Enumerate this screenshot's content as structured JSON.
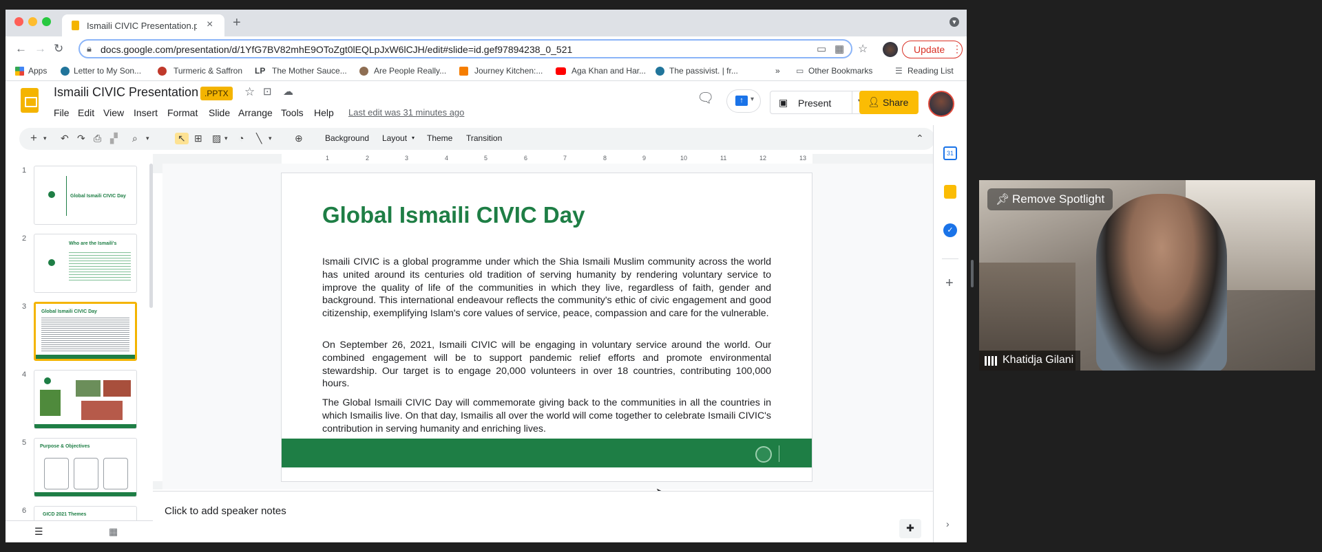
{
  "browser": {
    "tab_title": "Ismaili CIVIC Presentation.pptx",
    "url": "docs.google.com/presentation/d/1YfG7BV82mhE9OToZgt0lEQLpJxW6lCJH/edit#slide=id.gef97894238_0_521",
    "update_label": "Update",
    "bookmarks": [
      "Apps",
      "Letter to My Son...",
      "Turmeric & Saffron",
      "The Mother Sauce...",
      "Are People Really...",
      "Journey Kitchen:...",
      "Aga Khan and Har...",
      "The passivist. | fr..."
    ],
    "other_bookmarks": "Other Bookmarks",
    "reading_list": "Reading List"
  },
  "app": {
    "doc_title": "Ismaili CIVIC Presentation",
    "file_badge": ".PPTX",
    "menu": [
      "File",
      "Edit",
      "View",
      "Insert",
      "Format",
      "Slide",
      "Arrange",
      "Tools",
      "Help"
    ],
    "last_edit": "Last edit was 31 minutes ago",
    "present_label": "Present",
    "share_label": "Share"
  },
  "toolbar": {
    "background": "Background",
    "layout": "Layout",
    "theme": "Theme",
    "transition": "Transition"
  },
  "filmstrip": {
    "slides": [
      {
        "num": "1",
        "title": "Global Ismaili CIVIC Day"
      },
      {
        "num": "2",
        "title": "Who are the Ismaili's"
      },
      {
        "num": "3",
        "title": "Global Ismaili CIVIC Day"
      },
      {
        "num": "4",
        "title": ""
      },
      {
        "num": "5",
        "title": "Purpose & Objectives"
      },
      {
        "num": "6",
        "title": "GICD 2021 Themes"
      }
    ]
  },
  "ruler": [
    "1",
    "2",
    "3",
    "4",
    "5",
    "6",
    "7",
    "8",
    "9",
    "10",
    "11",
    "12",
    "13"
  ],
  "slide": {
    "title": "Global Ismaili CIVIC Day",
    "paragraphs": [
      "Ismaili CIVIC is a global programme under which the Shia Ismaili Muslim community across the world has united around its centuries old tradition of serving humanity by rendering voluntary service to improve the quality of life of the communities in which they live, regardless of faith, gender and background. This international endeavour reflects the community's ethic of civic engagement and good citizenship, exemplifying Islam's core values of service, peace, compassion and care for the vulnerable.",
      "On September 26, 2021, Ismaili CIVIC will be engaging in voluntary service around the world. Our combined engagement will be to support pandemic relief efforts and promote environmental stewardship. Our target is to engage 20,000 volunteers in over 18 countries, contributing 100,000 hours.",
      "The Global Ismaili CIVIC Day will commemorate giving back to the communities in all the countries in which Ismailis live. On that day, Ismailis all over the world will come together to celebrate Ismaili CIVIC's contribution in serving humanity and enriching lives."
    ]
  },
  "notes": {
    "placeholder": "Click to add speaker notes"
  },
  "video": {
    "spotlight": "Remove Spotlight",
    "participant": "Khatidja Gilani"
  },
  "colors": {
    "accent_green": "#1e7e45",
    "accent_yellow": "#f4b400"
  }
}
